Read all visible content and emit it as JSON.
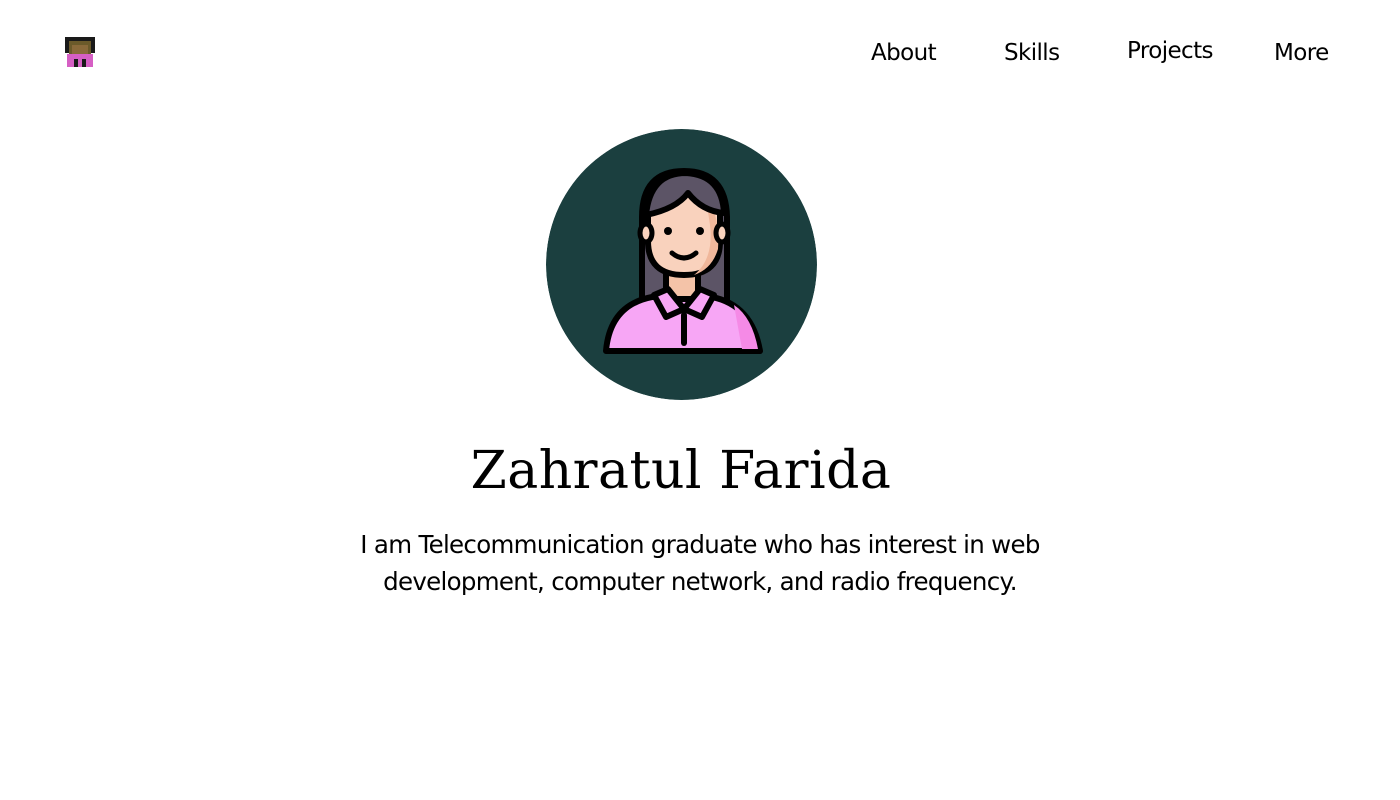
{
  "header": {
    "logo_icon": "girl-avatar-pixel-icon",
    "nav": {
      "about": "About",
      "skills": "Skills",
      "projects": "Projects",
      "more": "More"
    }
  },
  "hero": {
    "avatar_icon": "woman-avatar-icon",
    "avatar_bg_color": "#1b3f3f",
    "name": "Zahratul Farida",
    "bio": "I am Telecommunication graduate who has interest in web development, computer network, and radio frequency."
  }
}
